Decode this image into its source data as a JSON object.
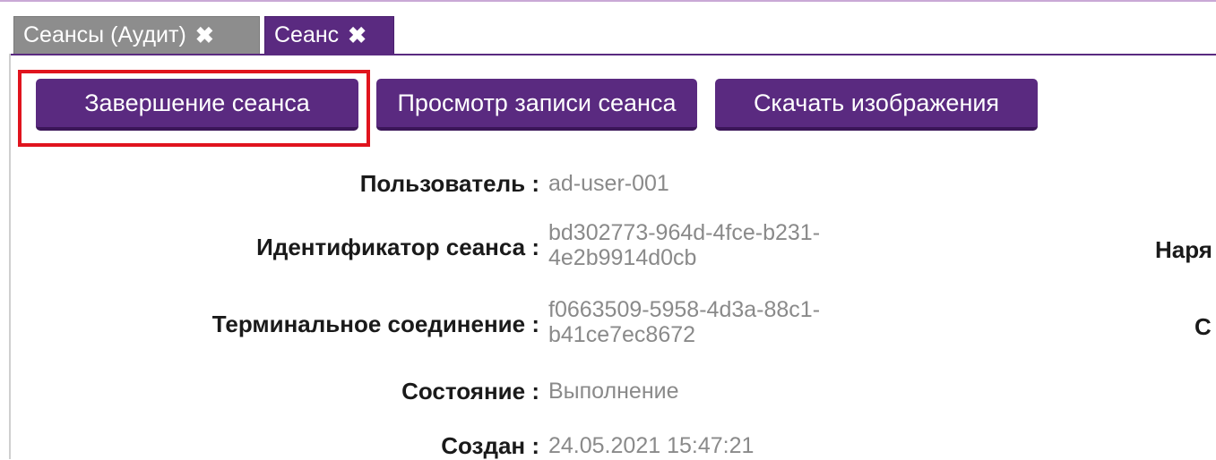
{
  "tabs": [
    {
      "label": "Сеансы (Аудит)",
      "close": "✖",
      "active": false
    },
    {
      "label": "Сеанс",
      "close": "✖",
      "active": true
    }
  ],
  "toolbar": {
    "end_session": "Завершение сеанса",
    "view_recording": "Просмотр записи сеанса",
    "download_images": "Скачать изображения"
  },
  "fields": {
    "user": {
      "label": "Пользователь :",
      "value": "ad-user-001"
    },
    "session_id": {
      "label": "Идентификатор сеанса :",
      "value_line1": "bd302773-964d-4fce-b231-",
      "value_line2": "4e2b9914d0cb"
    },
    "terminal_connection": {
      "label": "Терминальное соединение :",
      "value_line1": "f0663509-5958-4d3a-88c1-",
      "value_line2": "b41ce7ec8672"
    },
    "state": {
      "label": "Состояние :",
      "value": "Выполнение"
    },
    "created": {
      "label": "Создан :",
      "value": "24.05.2021 15:47:21"
    }
  },
  "right_column": {
    "label_1": "Наря",
    "label_2": "С"
  },
  "colors": {
    "accent": "#5a2a80",
    "highlight": "#e0141e",
    "inactive_tab": "#8d8d8d"
  }
}
